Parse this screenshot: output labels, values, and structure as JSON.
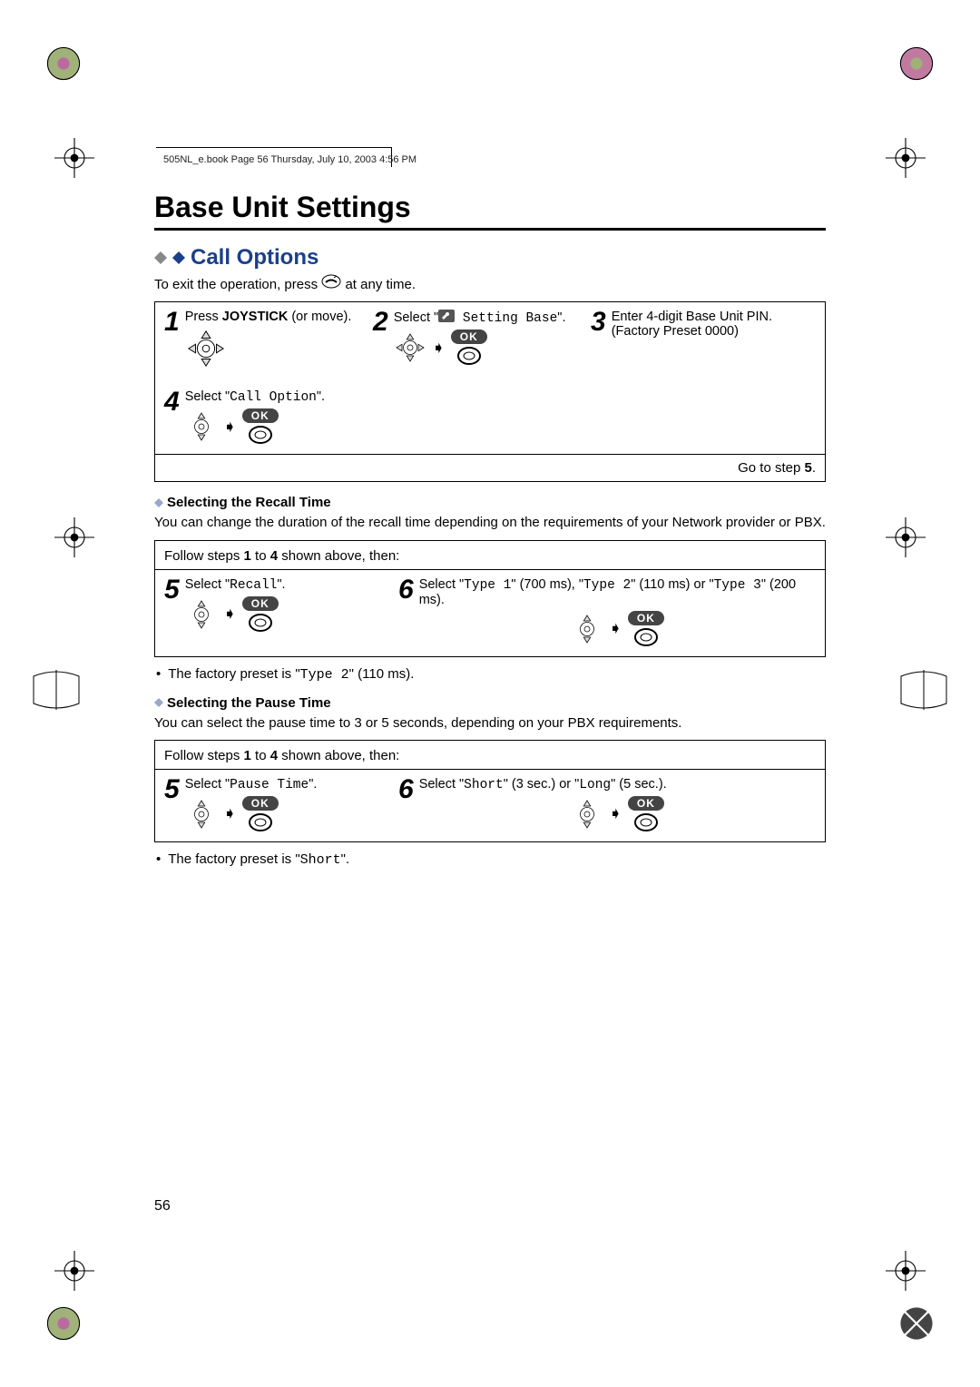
{
  "running_header": "505NL_e.book  Page 56  Thursday, July 10, 2003  4:56 PM",
  "page_number": "56",
  "title": "Base Unit Settings",
  "section_heading": "Call Options",
  "exit_text_a": "To exit the operation, press ",
  "exit_text_b": " at any time.",
  "step1": {
    "pre": "Press ",
    "bold": "JOYSTICK",
    "post": " (or move)."
  },
  "step2": {
    "pre": "Select \"",
    "mono": " Setting Base",
    "post": "\"."
  },
  "step3": {
    "l1": "Enter 4-digit Base Unit PIN.",
    "l2": "(Factory Preset 0000)"
  },
  "step4": {
    "pre": "Select \"",
    "mono": "Call Option",
    "post": "\"."
  },
  "go_step5": "Go to step 5.",
  "recall_heading": "Selecting the Recall Time",
  "recall_body": "You can change the duration of the recall time depending on the requirements of your Network provider or PBX.",
  "follow_label_a": "Follow steps ",
  "follow_label_b": " to ",
  "follow_label_c": " shown above, then:",
  "bold1": "1",
  "bold4": "4",
  "bold5_text": "5",
  "step5a": {
    "pre": "Select \"",
    "mono": "Recall",
    "post": "\"."
  },
  "step6a": {
    "pre": "Select \"",
    "m1": "Type 1",
    "mid1": "\" (700 ms), \"",
    "m2": "Type 2",
    "mid2": "\" (110 ms) or \"",
    "m3": "Type 3",
    "post": "\" (200 ms)."
  },
  "factory_recall_a": "The factory preset is \"",
  "factory_recall_mono": "Type 2",
  "factory_recall_b": "\" (110 ms).",
  "pause_heading": "Selecting the Pause Time",
  "pause_body": "You can select the pause time to 3 or 5 seconds, depending on your PBX requirements.",
  "step5b": {
    "pre": "Select \"",
    "mono": "Pause Time",
    "post": "\"."
  },
  "step6b": {
    "pre": "Select \"",
    "m1": "Short",
    "mid1": "\" (3 sec.) or \"",
    "m2": "Long",
    "post": "\" (5 sec.)."
  },
  "factory_pause_a": "The factory preset is \"",
  "factory_pause_mono": "Short",
  "factory_pause_b": "\".",
  "ok_label": "OK"
}
